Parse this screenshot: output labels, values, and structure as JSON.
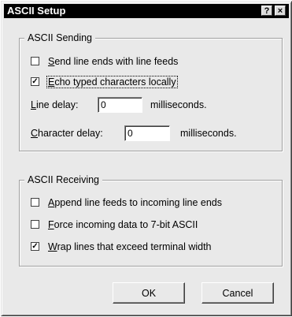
{
  "window": {
    "title": "ASCII Setup"
  },
  "title_buttons": {
    "help": "?",
    "close": "×"
  },
  "sending": {
    "title": "ASCII Sending",
    "send_line_ends": {
      "label_first": "S",
      "label_rest": "end line ends with line feeds",
      "checked": false
    },
    "echo_typed": {
      "label_first": "E",
      "label_rest": "cho typed characters locally",
      "checked": true
    },
    "line_delay": {
      "label_first": "L",
      "label_rest": "ine delay:",
      "value": "0",
      "unit": "milliseconds."
    },
    "char_delay": {
      "label_first": "C",
      "label_rest": "haracter delay:",
      "value": "0",
      "unit": "milliseconds."
    }
  },
  "receiving": {
    "title": "ASCII Receiving",
    "append_lf": {
      "label_first": "A",
      "label_rest": "ppend line feeds to incoming line ends",
      "checked": false
    },
    "force_7bit": {
      "label_first": "F",
      "label_rest": "orce incoming data to 7-bit ASCII",
      "checked": false
    },
    "wrap_lines": {
      "label_first": "W",
      "label_rest": "rap lines that exceed terminal width",
      "checked": true
    }
  },
  "buttons": {
    "ok": "OK",
    "cancel": "Cancel"
  },
  "check_glyph": "✓"
}
